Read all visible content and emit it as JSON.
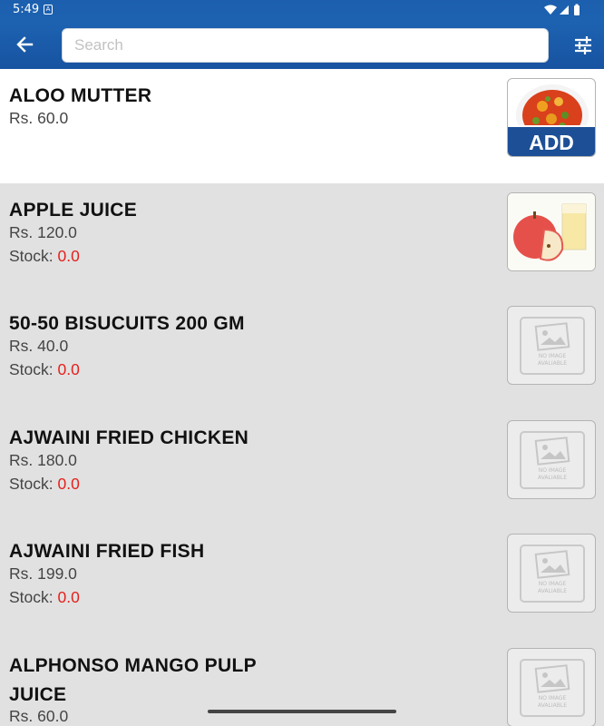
{
  "status_bar": {
    "time": "5:49",
    "notification_letter": "A"
  },
  "search": {
    "placeholder": "Search",
    "value": ""
  },
  "products": [
    {
      "name": "ALOO MUTTER",
      "price": "Rs. 60.0",
      "image": "aloo-mutter-dish",
      "action": "ADD"
    },
    {
      "name": "APPLE JUICE",
      "price": "Rs. 120.0",
      "stock_label": "Stock: ",
      "stock": "0.0",
      "image": "apple-juice"
    },
    {
      "name": "50-50 BISUCUITS 200 GM",
      "price": "Rs. 40.0",
      "stock_label": "Stock: ",
      "stock": "0.0",
      "image": "no-image-placeholder"
    },
    {
      "name": "AJWAINI FRIED CHICKEN",
      "price": "Rs. 180.0",
      "stock_label": "Stock: ",
      "stock": "0.0",
      "image": "no-image-placeholder"
    },
    {
      "name": "AJWAINI FRIED FISH",
      "price": "Rs. 199.0",
      "stock_label": "Stock: ",
      "stock": "0.0",
      "image": "no-image-placeholder"
    },
    {
      "name": "ALPHONSO MANGO PULP JUICE",
      "price": "Rs. 60.0",
      "image": "no-image-placeholder"
    }
  ],
  "placeholder_text": {
    "line1": "NO IMAGE",
    "line2": "AVALIABLE"
  },
  "colors": {
    "app_bar": "#1d63b2",
    "add_button": "#1c4f96",
    "stock_zero": "#e4201d"
  }
}
